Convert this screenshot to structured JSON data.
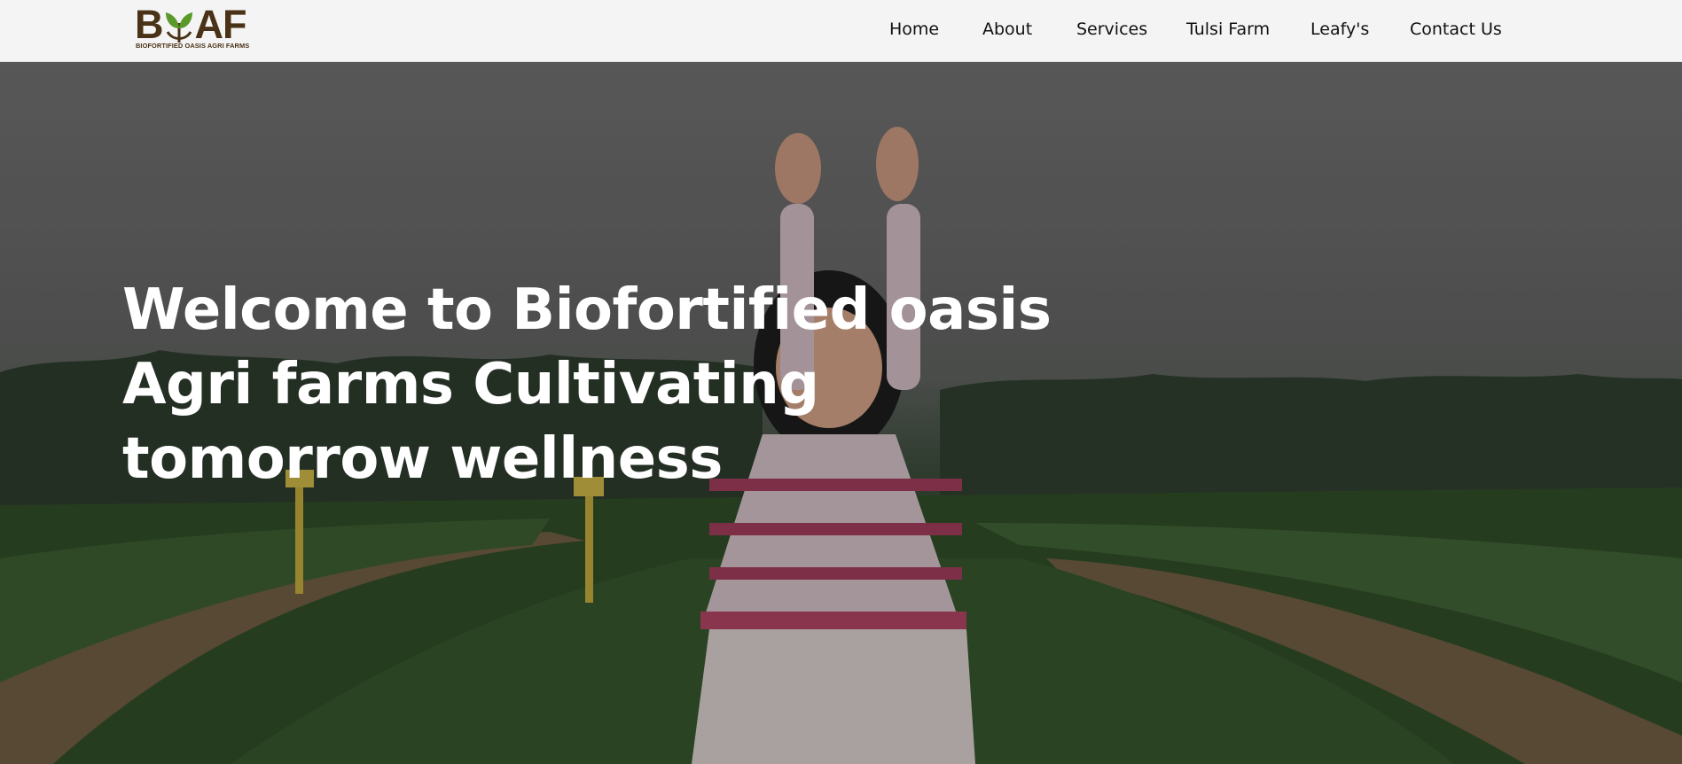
{
  "brand": {
    "logo_text": "BOAF",
    "tagline": "BIOFORTIFIED OASIS AGRI FARMS",
    "colors": {
      "brown": "#4a3216",
      "green": "#5a9a2a"
    },
    "icon": "sprouting-leaf-icon"
  },
  "nav": {
    "items": [
      {
        "label": "Home"
      },
      {
        "label": "About"
      },
      {
        "label": "Services"
      },
      {
        "label": "Tulsi Farm"
      },
      {
        "label": "Leafy's"
      },
      {
        "label": "Contact Us"
      }
    ]
  },
  "hero": {
    "title_lines": [
      "Welcome to Biofortified oasis",
      "Agri farms Cultivating",
      "tomorrow wellness"
    ],
    "image": "child-raising-arms-in-crop-field-photo"
  }
}
